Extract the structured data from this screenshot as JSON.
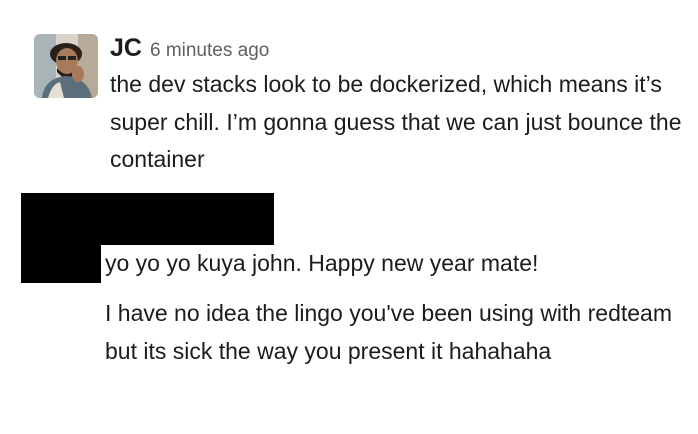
{
  "messages": [
    {
      "author": "JC",
      "timestamp": "6 minutes ago",
      "text": "the dev stacks look to be dockerized, which means it’s super chill. I’m gonna guess that we can just bounce the container"
    },
    {
      "first_line": "yo yo yo kuya john. Happy new year mate!",
      "text": "I have no idea the lingo you've been using with redteam but its sick the way you present it hahahaha"
    }
  ],
  "colors": {
    "text": "#1d1c1d",
    "timestamp": "#616061",
    "redaction": "#000000",
    "background": "#ffffff"
  }
}
